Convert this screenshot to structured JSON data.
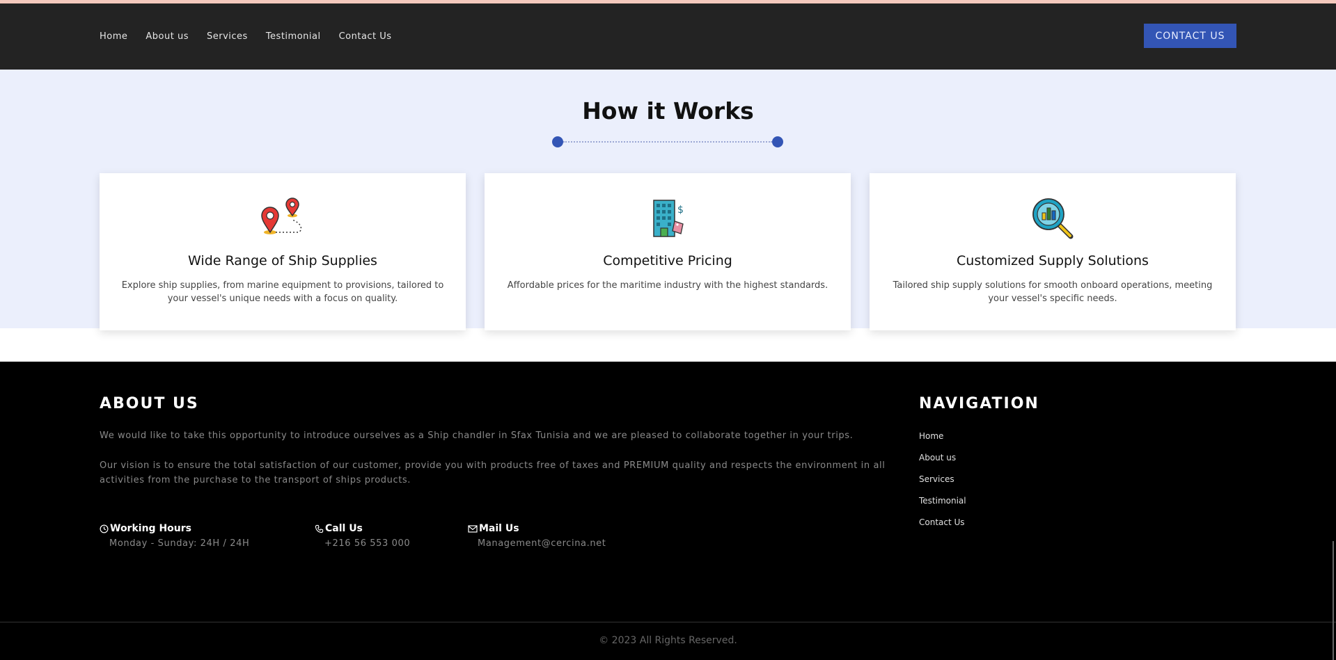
{
  "nav": {
    "links": [
      "Home",
      "About us",
      "Services",
      "Testimonial",
      "Contact Us"
    ],
    "cta": "CONTACT US"
  },
  "how": {
    "title": "How it Works",
    "cards": [
      {
        "icon": "map-pins-icon",
        "title": "Wide Range of Ship Supplies",
        "text": "Explore ship supplies, from marine equipment to provisions, tailored to your vessel's unique needs with a focus on quality."
      },
      {
        "icon": "building-price-icon",
        "title": "Competitive Pricing",
        "text": "Affordable prices for the maritime industry with the highest standards."
      },
      {
        "icon": "magnifier-chart-icon",
        "title": "Customized Supply Solutions",
        "text": "Tailored ship supply solutions for smooth onboard operations, meeting your vessel's specific needs."
      }
    ]
  },
  "footer": {
    "about_title": "ABOUT US",
    "about_p1": "We would like to take this opportunity to introduce ourselves as a Ship chandler in Sfax Tunisia and we are pleased to collaborate together in your trips.",
    "about_p2": "Our vision is to ensure the total satisfaction of our customer, provide you with products free of taxes and PREMIUM quality and respects the environment in all activities from the purchase to the transport of ships products.",
    "hours_label": "Working Hours",
    "hours_value": "Monday - Sunday: 24H / 24H",
    "call_label": "Call Us",
    "call_value": "+216 56 553 000",
    "mail_label": "Mail Us",
    "mail_value": "Management@cercina.net",
    "nav_title": "NAVIGATION",
    "nav_links": [
      "Home",
      "About us",
      "Services",
      "Testimonial",
      "Contact Us"
    ],
    "copyright": "© 2023 All Rights Reserved."
  },
  "colors": {
    "accent": "#3355b5",
    "navbar": "#232323",
    "section_bg": "#ebeffc",
    "footer": "#000000"
  }
}
